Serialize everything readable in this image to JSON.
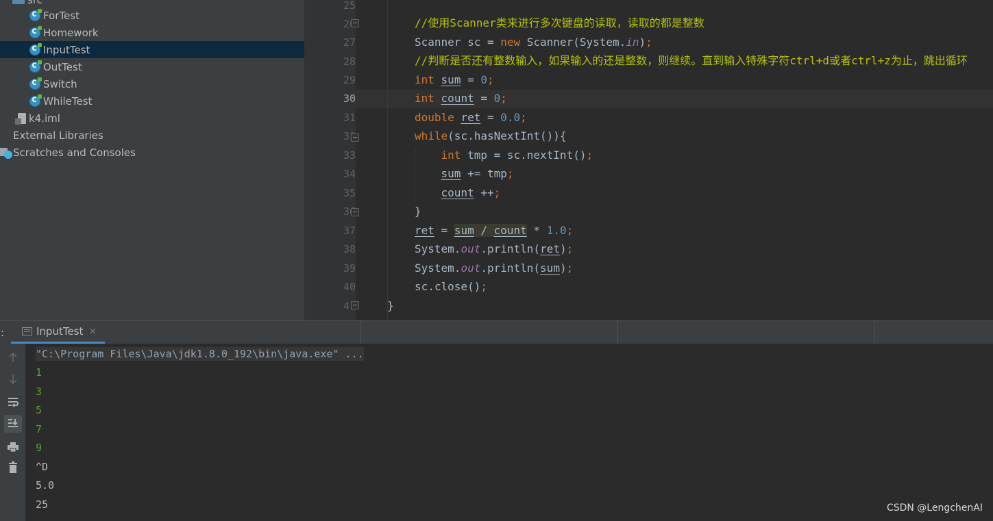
{
  "project_tree": {
    "partial_top_label": "src",
    "items": [
      {
        "label": "ForTest",
        "type": "class"
      },
      {
        "label": "Homework",
        "type": "class"
      },
      {
        "label": "InputTest",
        "type": "class",
        "selected": true
      },
      {
        "label": "OutTest",
        "type": "class"
      },
      {
        "label": "Switch",
        "type": "class"
      },
      {
        "label": "WhileTest",
        "type": "class"
      },
      {
        "label": "k4.iml",
        "type": "file"
      },
      {
        "label": "External Libraries",
        "type": "libraries"
      },
      {
        "label": "Scratches and Consoles",
        "type": "scratches"
      }
    ]
  },
  "editor": {
    "line_numbers": [
      "25",
      "26",
      "27",
      "28",
      "29",
      "30",
      "31",
      "32",
      "33",
      "34",
      "35",
      "36",
      "37",
      "38",
      "39",
      "40",
      "41"
    ],
    "current_line": "30",
    "comment_1": "//使用Scanner类来进行多次键盘的读取，读取的都是整数",
    "comment_2": "//判断是否还有整数输入，如果输入的还是整数，则继续。直到输入特殊字符ctrl+d或者ctrl+z为止，跳出循环"
  },
  "run_panel": {
    "left_label": ":",
    "tab_label": "InputTest",
    "tab_close": "×",
    "command": "\"C:\\Program Files\\Java\\jdk1.8.0_192\\bin\\java.exe\" ...",
    "input_lines": [
      "1",
      "3",
      "5",
      "7",
      "9"
    ],
    "output_lines": [
      "^D",
      "5.0",
      "25"
    ],
    "toolbar_icons": [
      "up-arrow-icon",
      "down-arrow-icon",
      "soft-wrap-icon",
      "scroll-to-end-icon",
      "print-icon",
      "trash-icon"
    ]
  },
  "watermark": "CSDN @LengchenAI",
  "colors": {
    "selection": "#0d293e",
    "keyword": "#cc7832",
    "number": "#6897bb",
    "comment": "#b5c30a",
    "static_field": "#9876aa",
    "console_input": "#5c9e2b"
  }
}
